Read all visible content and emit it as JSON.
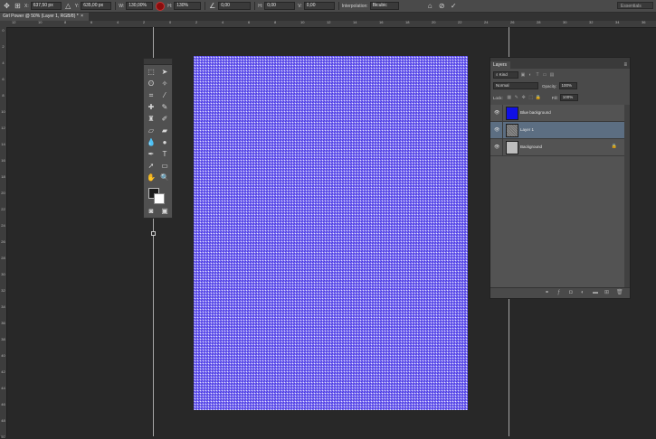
{
  "options_bar": {
    "x_label": "X:",
    "x_value": "637,50 px",
    "delta_icon": "delta-icon",
    "y_label": "Y:",
    "y_value": "635,00 px",
    "w_label": "W:",
    "w_value": "130,00%",
    "h_label": "H:",
    "h_value": "130%",
    "angle_value": "0,00",
    "hskew_label": "H:",
    "hskew_value": "0,00",
    "vskew_label": "V:",
    "vskew_value": "0,00",
    "interpolation_label": "Interpolation:",
    "interpolation_value": "Bicubic",
    "workspace": "Essentials",
    "ref_color": "#8b0d0d"
  },
  "document_tab": {
    "title": "Girl Power @ 50% (Layer 1, RGB/8)",
    "modified": "*"
  },
  "ruler": {
    "h_ticks": [
      "12",
      "10",
      "8",
      "6",
      "4",
      "2",
      "0",
      "2",
      "4",
      "6",
      "8",
      "10",
      "12",
      "14",
      "16",
      "18",
      "20",
      "22",
      "24",
      "26",
      "28",
      "30",
      "32",
      "34",
      "36"
    ],
    "v_ticks": [
      "0",
      "2",
      "4",
      "6",
      "8",
      "10",
      "12",
      "14",
      "16",
      "18",
      "20",
      "22",
      "24",
      "26",
      "28",
      "30",
      "32",
      "34",
      "36",
      "38",
      "40",
      "42",
      "44",
      "46",
      "48",
      "50"
    ]
  },
  "layers_panel": {
    "tab_label": "Layers",
    "kind_label": "Kind",
    "blend_mode": "Normal",
    "opacity_label": "Opacity:",
    "opacity_value": "100%",
    "lock_label": "Lock:",
    "fill_label": "Fill:",
    "fill_value": "100%",
    "layers": [
      {
        "name": "Blue background",
        "thumb_color": "#1010e6",
        "visible": true,
        "selected": false
      },
      {
        "name": "Layer 1",
        "thumb_color": "#7a7a7a",
        "visible": true,
        "selected": true
      },
      {
        "name": "Background",
        "thumb_color": "#bdbdbd",
        "visible": true,
        "selected": false,
        "locked": true
      }
    ]
  },
  "colors": {
    "foreground": "#1c1c1c",
    "background": "#ffffff",
    "canvas_base": "#6a5cf0"
  }
}
